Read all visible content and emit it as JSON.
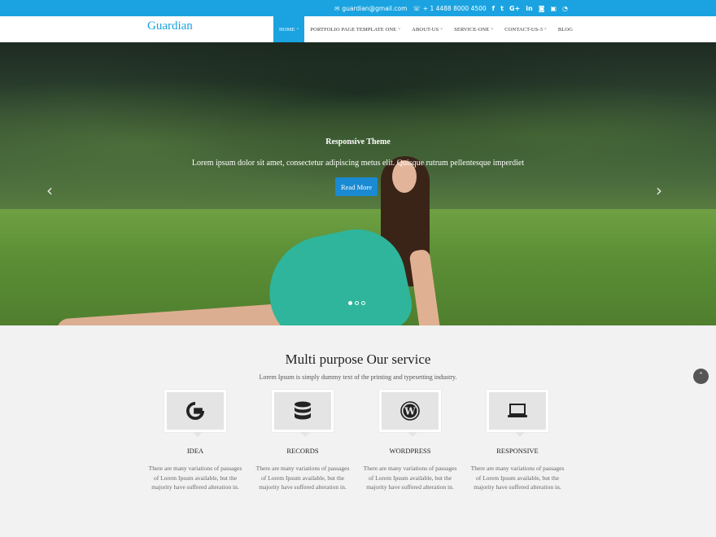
{
  "topbar": {
    "email": "guardian@gmail.com",
    "phone": "+ 1 4488 8000 4500",
    "social_icons": [
      "facebook-icon",
      "twitter-icon",
      "google-plus-icon",
      "linkedin-icon",
      "flickr-icon",
      "youtube-icon",
      "rss-icon"
    ]
  },
  "header": {
    "logo": "Guardian",
    "nav": [
      {
        "label": "HOME",
        "caret": "˅"
      },
      {
        "label": "PORTFOLIO PAGE TEMPLATE ONE",
        "caret": "˅"
      },
      {
        "label": "ABOUT-US",
        "caret": "˅"
      },
      {
        "label": "SERVICE-ONE",
        "caret": "˅"
      },
      {
        "label": "CONTACT-US-3",
        "caret": "˅"
      },
      {
        "label": "BLOG",
        "caret": ""
      }
    ]
  },
  "hero": {
    "title": "Responsive Theme",
    "text": "Lorem ipsum dolor sit amet, consectetur adipiscing metus elit. Quisque rutrum pellentesque imperdiet",
    "button": "Read More",
    "slide_count": 3,
    "active_slide": 1
  },
  "services": {
    "title": "Multi purpose Our service",
    "subtitle": "Lorem Ipsum is simply dummy text of the printing and typesetting industry.",
    "items": [
      {
        "icon": "google-icon",
        "title": "IDEA",
        "desc": "There are many variations of passages of Lorem Ipsum available, but the majority have suffered alteration in."
      },
      {
        "icon": "database-icon",
        "title": "RECORDS",
        "desc": "There are many variations of passages of Lorem Ipsum available, but the majority have suffered alteration in."
      },
      {
        "icon": "wordpress-icon",
        "title": "WORDPRESS",
        "desc": "There are many variations of passages of Lorem Ipsum available, but the majority have suffered alteration in."
      },
      {
        "icon": "laptop-icon",
        "title": "RESPONSIVE",
        "desc": "There are many variations of passages of Lorem Ipsum available, but the majority have suffered alteration in."
      }
    ]
  },
  "colors": {
    "accent": "#1aa3e0",
    "button": "#1a8ad2"
  }
}
